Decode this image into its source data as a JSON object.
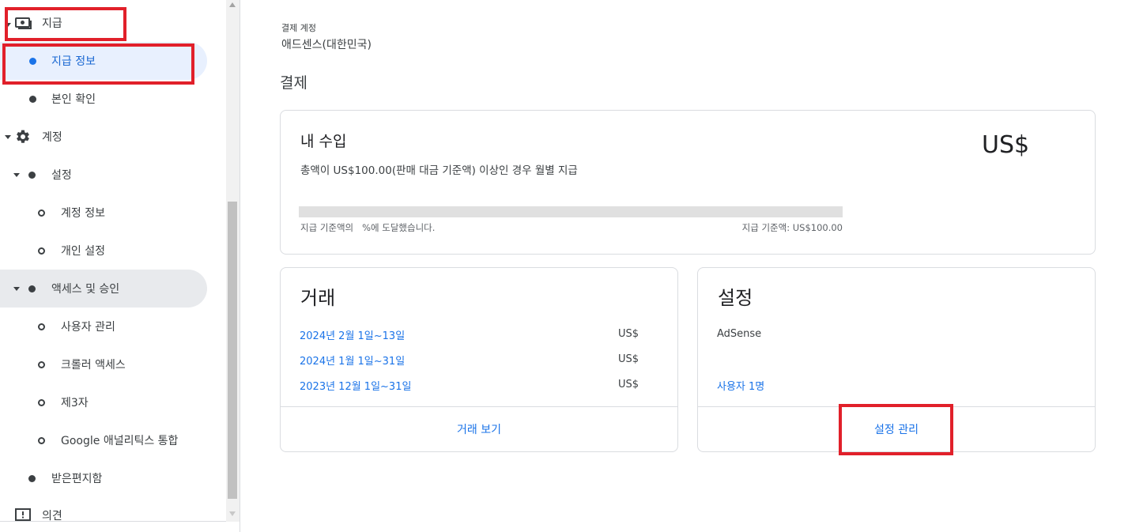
{
  "sidebar": {
    "payments": {
      "label": "지급",
      "icon": "money-icon"
    },
    "payment_info": {
      "label": "지급 정보"
    },
    "identity": {
      "label": "본인 확인"
    },
    "account": {
      "label": "계정",
      "icon": "gear-icon"
    },
    "settings": {
      "label": "설정"
    },
    "account_info": {
      "label": "계정 정보"
    },
    "personal_settings": {
      "label": "개인 설정"
    },
    "access": {
      "label": "액세스 및 승인"
    },
    "user_mgmt": {
      "label": "사용자 관리"
    },
    "crawler": {
      "label": "크롤러 액세스"
    },
    "third_party": {
      "label": "제3자"
    },
    "analytics": {
      "label": "Google 애널리틱스 통합"
    },
    "inbox": {
      "label": "받은편지함"
    },
    "feedback": {
      "label": "의견",
      "icon": "feedback-icon"
    }
  },
  "main": {
    "account_label": "결제 계정",
    "account_value": "애드센스(대한민국)",
    "section_title": "결제",
    "earnings": {
      "title": "내 수입",
      "amount": "US$",
      "subtitle": "총액이 US$100.00(판매 대금 기준액) 이상인 경우 월별 지급",
      "progress_percent": 0,
      "progress_left": "지급 기준액의   %에 도달했습니다.",
      "progress_right": "지급 기준액: US$100.00"
    },
    "transactions": {
      "title": "거래",
      "rows": [
        {
          "period": "2024년 2월 1일~13일",
          "amount": "US$"
        },
        {
          "period": "2024년 1월 1일~31일",
          "amount": "US$"
        },
        {
          "period": "2023년 12월 1일~31일",
          "amount": "US$"
        }
      ],
      "footer": "거래 보기"
    },
    "settings_card": {
      "title": "설정",
      "product": "AdSense",
      "users_link": "사용자 1명",
      "footer": "설정 관리"
    }
  },
  "colors": {
    "accent": "#1a73e8",
    "active_bg": "#e8f0fe",
    "highlight": "#e1202a"
  }
}
